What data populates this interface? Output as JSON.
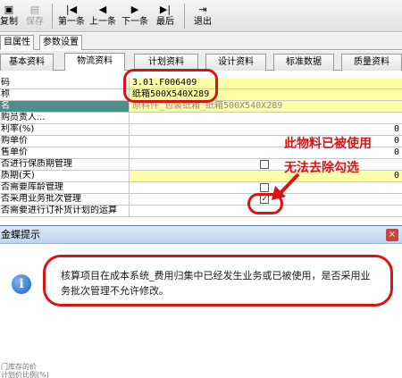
{
  "toolbar": {
    "copy_label": "复制",
    "save_label": "保存",
    "first_label": "第一条",
    "prev_label": "上一条",
    "next_label": "下一条",
    "last_label": "最后",
    "exit_label": "退出",
    "nav_arrow": "◀",
    "nav_arrow_next": "▶",
    "first_glyph": "|◀",
    "last_glyph": "▶|",
    "exit_glyph": "⇥"
  },
  "outer_tabs": [
    "目属性",
    "参数设置"
  ],
  "inner_tabs": [
    "基本资料",
    "物流资料",
    "计划资料",
    "设计资料",
    "标准数据",
    "质量资料"
  ],
  "grid": {
    "rows": [
      {
        "label": "码",
        "value": "3.01.F006409"
      },
      {
        "label": "称",
        "value": "纸箱500X540X289"
      },
      {
        "label": "名",
        "value": "原料件_包装纸箱_纸箱500X540X289"
      },
      {
        "label": "购员责人...",
        "value": ""
      },
      {
        "label": "利率(%)",
        "value": "",
        "num": "0"
      },
      {
        "label": "购单价",
        "value": "",
        "num": "0"
      },
      {
        "label": "售单价",
        "value": "",
        "num": "0"
      },
      {
        "label": "否进行保质期管理",
        "value": ""
      },
      {
        "label": "质期(天)",
        "value": "",
        "num": "0"
      },
      {
        "label": "否需要库龄管理",
        "value": ""
      },
      {
        "label": "否采用业务批次管理",
        "value": ""
      },
      {
        "label": "否需要进行订补货计划的运算",
        "value": ""
      }
    ],
    "check_mark": "✓"
  },
  "annotations": {
    "line1": "此物料已被使用",
    "line2": "无法去除勾选"
  },
  "dialog": {
    "title": "金蝶提示",
    "close_glyph": "×",
    "info_glyph": "i",
    "message": "核算项目在成本系统_费用归集中已经发生业务或已被使用，是否采用业务批次管理不允许修改。",
    "bottom_row_1": "门库存的价",
    "bottom_row_2": "计划价比例(%)"
  },
  "colors": {
    "annotation_red": "#d81515",
    "teal_row": "#4f8d8d",
    "field_yellow": "#ffffa8"
  }
}
